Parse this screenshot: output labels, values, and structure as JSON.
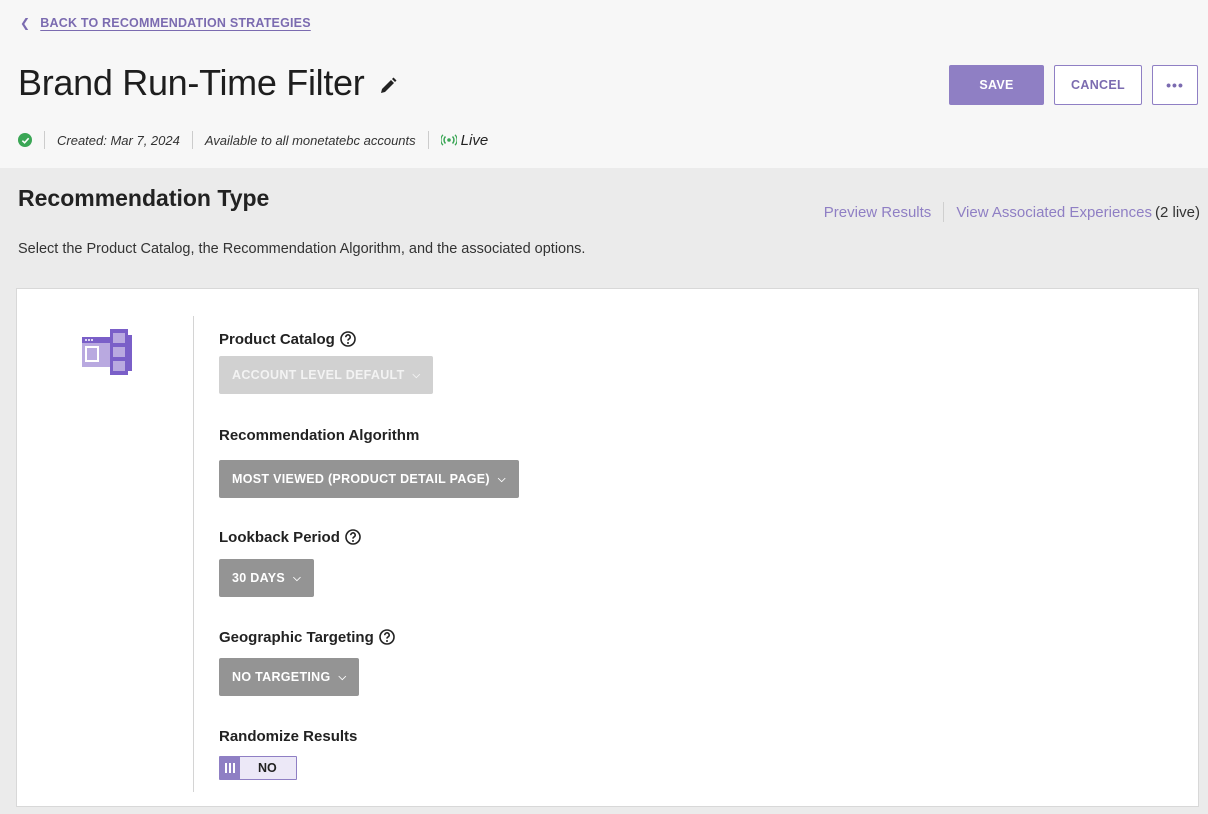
{
  "header": {
    "back_link": "BACK TO RECOMMENDATION STRATEGIES",
    "title": "Brand Run-Time Filter",
    "actions": {
      "save": "SAVE",
      "cancel": "CANCEL",
      "more": "•••"
    },
    "meta": {
      "created": "Created: Mar 7, 2024",
      "availability": "Available to all monetatebc accounts",
      "status": "Live"
    }
  },
  "section": {
    "title": "Recommendation Type",
    "links": {
      "preview": "Preview Results",
      "associated": "View Associated Experiences",
      "associated_count": "(2 live)"
    },
    "description": "Select the Product Catalog, the Recommendation Algorithm, and the associated options."
  },
  "form": {
    "product_catalog": {
      "label": "Product Catalog",
      "value": "ACCOUNT LEVEL DEFAULT"
    },
    "algorithm": {
      "label": "Recommendation Algorithm",
      "value": "MOST VIEWED (PRODUCT DETAIL PAGE)"
    },
    "lookback": {
      "label": "Lookback Period",
      "value": "30 DAYS"
    },
    "geo": {
      "label": "Geographic Targeting",
      "value": "NO TARGETING"
    },
    "randomize": {
      "label": "Randomize Results",
      "value": "NO"
    }
  },
  "colors": {
    "accent": "#8f7fc4",
    "success": "#3aa655",
    "dropdown": "#949494",
    "dropdown_disabled": "#d1d1d1"
  }
}
